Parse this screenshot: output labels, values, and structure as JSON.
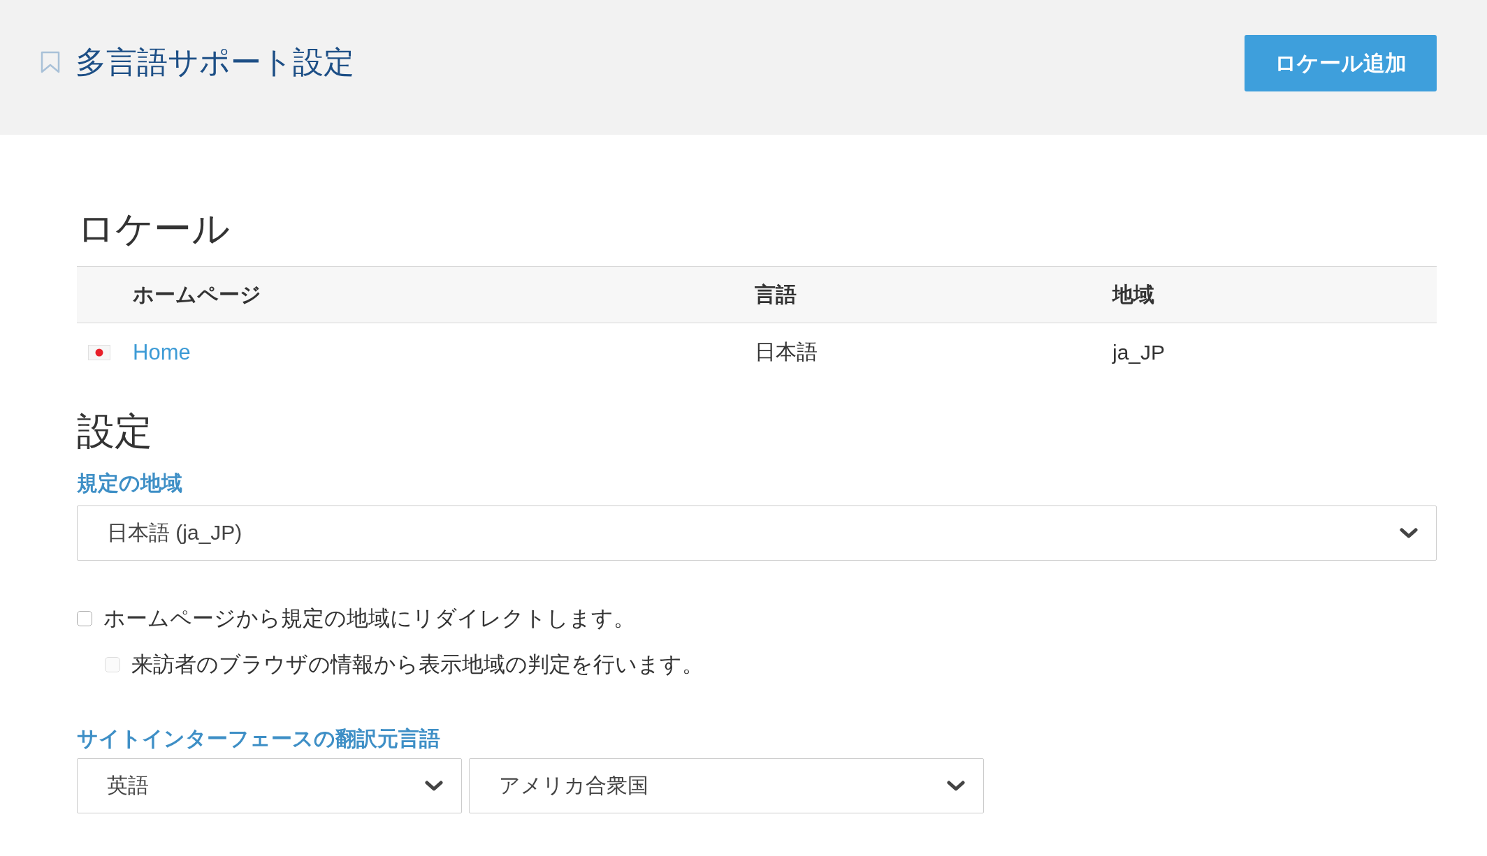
{
  "header": {
    "title": "多言語サポート設定",
    "add_button": "ロケール追加"
  },
  "locales": {
    "heading": "ロケール",
    "columns": [
      "ホームページ",
      "言語",
      "地域"
    ],
    "rows": [
      {
        "homepage": "Home",
        "language": "日本語",
        "region": "ja_JP"
      }
    ]
  },
  "settings": {
    "heading": "設定",
    "default_region": {
      "label": "規定の地域",
      "value": "日本語 (ja_JP)"
    },
    "options": [
      {
        "label": "ホームページから規定の地域にリダイレクトします。",
        "checked": false,
        "disabled": false,
        "children": [
          {
            "label": "来訪者のブラウザの情報から表示地域の判定を行います。",
            "checked": false,
            "disabled": true
          }
        ]
      }
    ],
    "source_language": {
      "label": "サイトインターフェースの翻訳元言語",
      "selects": [
        {
          "value": "英語"
        },
        {
          "value": "アメリカ合衆国"
        }
      ]
    }
  }
}
